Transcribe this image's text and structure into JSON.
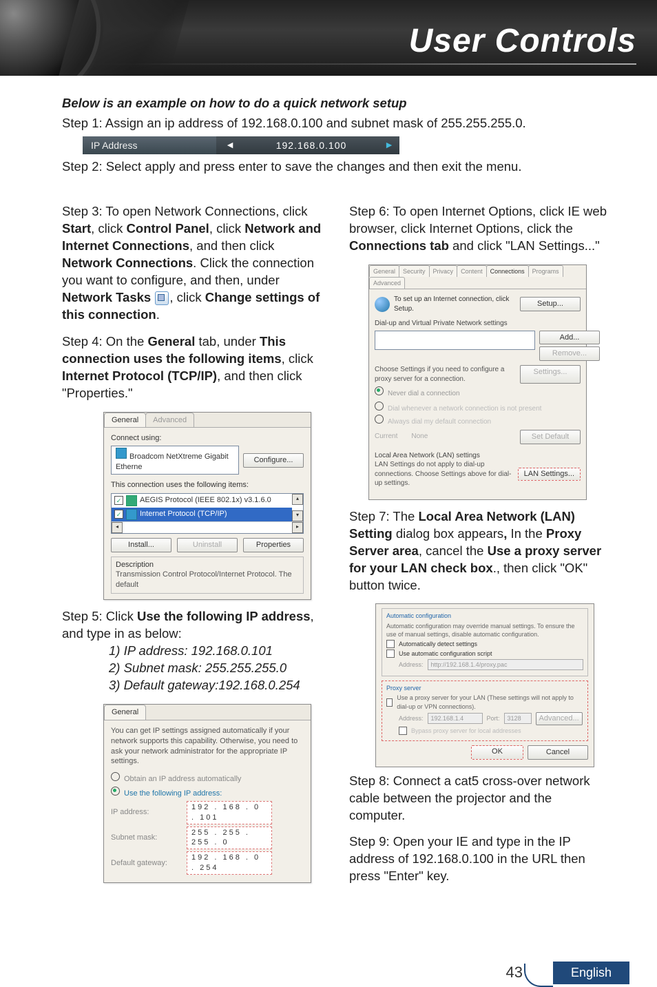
{
  "header": {
    "title": "User Controls"
  },
  "intro": {
    "heading": "Below is an example on how to do a quick network setup",
    "step1": "Step 1: Assign an ip address of 192.168.0.100 and subnet mask of 255.255.255.0.",
    "ipbar_label": "IP Address",
    "ipbar_value": "192.168.0.100",
    "step2": "Step 2: Select apply and press enter to save the changes and then exit the menu."
  },
  "left": {
    "step3": {
      "lead": "Step 3: To open Network Connections, click ",
      "parts": [
        "Start",
        ", click ",
        "Control Panel",
        ", click ",
        "Network and Internet Connections",
        ", and then click ",
        "Network Connections",
        ". Click the connection you want to configure, and then, under ",
        "Network Tasks",
        " "
      ],
      "tail": [
        ", click ",
        "Change settings of this connection",
        "."
      ]
    },
    "step4": {
      "lead": "Step 4: On the ",
      "parts": [
        "General",
        " tab, under ",
        "This connection uses the following items",
        ", click ",
        "Internet Protocol (TCP/IP)",
        ", and then click \"Properties.\""
      ]
    },
    "dlg_conn": {
      "tabs": [
        "General",
        "Advanced"
      ],
      "connect_using_label": "Connect using:",
      "adapter": "Broadcom NetXtreme Gigabit Etherne",
      "configure_btn": "Configure...",
      "uses_label": "This connection uses the following items:",
      "item1": "AEGIS Protocol (IEEE 802.1x) v3.1.6.0",
      "item2": "Internet Protocol (TCP/IP)",
      "install_btn": "Install...",
      "uninstall_btn": "Uninstall",
      "properties_btn": "Properties",
      "desc_label": "Description",
      "desc_text": "Transmission Control Protocol/Internet Protocol. The default"
    },
    "step5": {
      "lead": "Step 5: Click ",
      "bold": "Use the following IP address",
      "tail": ", and type in as below:",
      "l1": "1) IP address: 192.168.0.101",
      "l2": "2) Subnet mask: 255.255.255.0",
      "l3": "3) Default gateway:192.168.0.254"
    },
    "dlg_tcpip": {
      "tab": "General",
      "blurb": "You can get IP settings assigned automatically if your network supports this capability. Otherwise, you need to ask your network administrator for the appropriate IP settings.",
      "radio_auto": "Obtain an IP address automatically",
      "radio_manual": "Use the following IP address:",
      "ip_lbl": "IP address:",
      "ip_val": "192 . 168 .   0  . 101",
      "mask_lbl": "Subnet mask:",
      "mask_val": "255 . 255 . 255 .   0",
      "gw_lbl": "Default gateway:",
      "gw_val": "192 . 168 .   0  . 254"
    }
  },
  "right": {
    "step6": {
      "lead": "Step 6: To open Internet Options, click IE web browser, click Internet Options, click the ",
      "bold": "Connections tab",
      "tail": " and click \"LAN Settings...\""
    },
    "dlg_io": {
      "tabs": [
        "General",
        "Security",
        "Privacy",
        "Content",
        "Connections",
        "Programs",
        "Advanced"
      ],
      "setup_text": "To set up an Internet connection, click Setup.",
      "setup_btn": "Setup...",
      "dialup_label": "Dial-up and Virtual Private Network settings",
      "add_btn": "Add...",
      "remove_btn": "Remove...",
      "choose_text": "Choose Settings if you need to configure a proxy server for a connection.",
      "settings_btn": "Settings...",
      "r1": "Never dial a connection",
      "r2": "Dial whenever a network connection is not present",
      "r3": "Always dial my default connection",
      "current_label": "Current",
      "current_value": "None",
      "setdefault_btn": "Set Default",
      "lan_label": "Local Area Network (LAN) settings",
      "lan_text": "LAN Settings do not apply to dial-up connections. Choose Settings above for dial-up settings.",
      "lan_btn": "LAN Settings..."
    },
    "step7": {
      "lead": "Step 7: The ",
      "b1": "Local Area Network (LAN) Setting",
      "m1": " dialog box appears",
      "comma": ",",
      "m2": " In the ",
      "b2": "Proxy Server area",
      "m3": ", cancel the ",
      "b3": "Use a proxy server for your LAN check box",
      "tail": "., then click \"OK\" button twice."
    },
    "dlg_lan": {
      "auto_title": "Automatic configuration",
      "auto_blurb": "Automatic configuration may override manual settings. To ensure the use of manual settings, disable automatic configuration.",
      "auto_detect": "Automatically detect settings",
      "auto_script": "Use automatic configuration script",
      "addr_lbl": "Address:",
      "addr_val": "http://192.168.1.4/proxy.pac",
      "proxy_title": "Proxy server",
      "proxy_use": "Use a proxy server for your LAN (These settings will not apply to dial-up or VPN connections).",
      "paddr_lbl": "Address:",
      "paddr_val": "192.168.1.4",
      "port_lbl": "Port:",
      "port_val": "3128",
      "adv_btn": "Advanced...",
      "bypass": "Bypass proxy server for local addresses",
      "ok_btn": "OK",
      "cancel_btn": "Cancel"
    },
    "step8": "Step 8: Connect a cat5 cross-over network cable between the projector and the computer.",
    "step9": "Step 9: Open your IE and type in the IP address of 192.168.0.100 in the URL then press \"Enter\" key."
  },
  "footer": {
    "page": "43",
    "language": "English"
  }
}
